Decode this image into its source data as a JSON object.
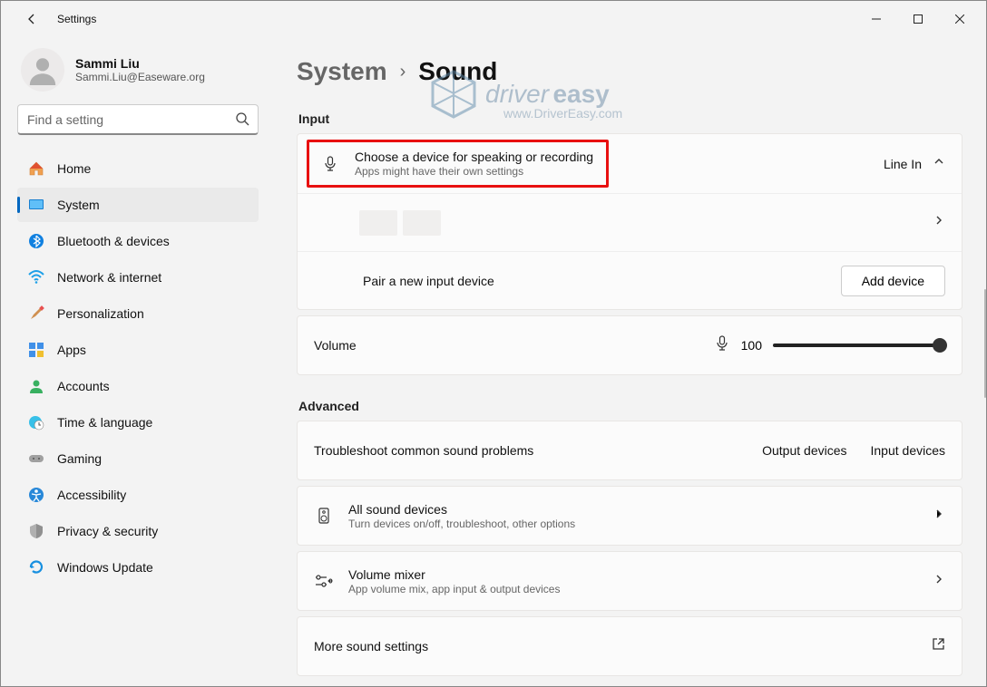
{
  "window": {
    "title": "Settings"
  },
  "profile": {
    "name": "Sammi Liu",
    "email": "Sammi.Liu@Easeware.org"
  },
  "search": {
    "placeholder": "Find a setting"
  },
  "nav": {
    "home": "Home",
    "system": "System",
    "bluetooth": "Bluetooth & devices",
    "network": "Network & internet",
    "personalization": "Personalization",
    "apps": "Apps",
    "accounts": "Accounts",
    "time": "Time & language",
    "gaming": "Gaming",
    "accessibility": "Accessibility",
    "privacy": "Privacy & security",
    "update": "Windows Update"
  },
  "breadcrumb": {
    "parent": "System",
    "current": "Sound"
  },
  "sections": {
    "input": "Input",
    "advanced": "Advanced"
  },
  "input": {
    "choose_title": "Choose a device for speaking or recording",
    "choose_sub": "Apps might have their own settings",
    "choose_value": "Line In",
    "pair_title": "Pair a new input device",
    "add_device": "Add device",
    "volume_label": "Volume",
    "volume_value": "100"
  },
  "advanced": {
    "troubleshoot": "Troubleshoot common sound problems",
    "output_devices": "Output devices",
    "input_devices": "Input devices",
    "all_title": "All sound devices",
    "all_sub": "Turn devices on/off, troubleshoot, other options",
    "mixer_title": "Volume mixer",
    "mixer_sub": "App volume mix, app input & output devices",
    "more": "More sound settings"
  },
  "watermark": {
    "brand1": "driver",
    "brand2": "easy",
    "url": "www.DriverEasy.com"
  }
}
